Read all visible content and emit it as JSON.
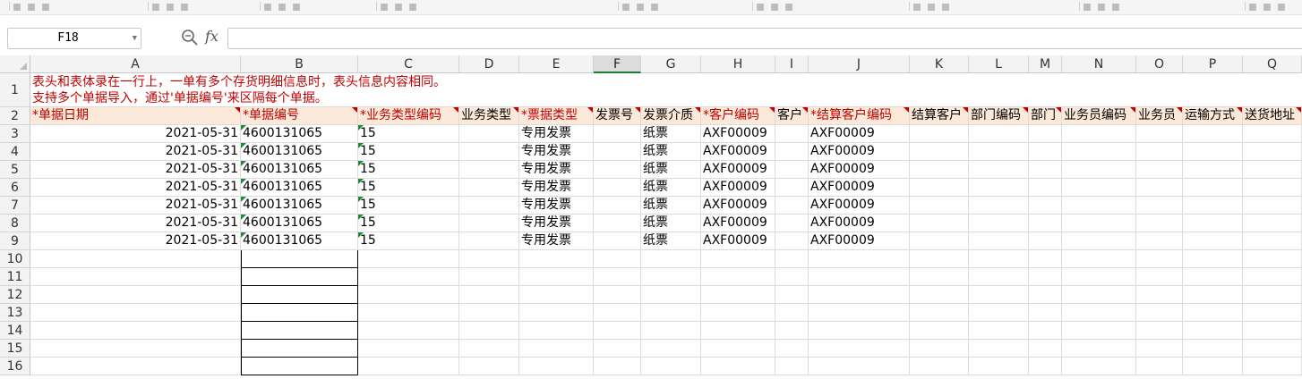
{
  "formula_bar": {
    "name_box": "F18",
    "fx_label": "fx",
    "formula": ""
  },
  "columns": [
    "A",
    "B",
    "C",
    "D",
    "E",
    "F",
    "G",
    "H",
    "I",
    "J",
    "K",
    "L",
    "M",
    "N",
    "O",
    "P",
    "Q"
  ],
  "selected_column": "F",
  "row_numbers": [
    "1",
    "2",
    "3",
    "4",
    "5",
    "6",
    "7",
    "8",
    "9",
    "10",
    "11",
    "12",
    "13",
    "14",
    "15",
    "16"
  ],
  "notes": {
    "line1": "表头和表体录在一行上，一单有多个存货明细信息时，表头信息内容相同。",
    "line2": "支持多个单据导入，通过'单据编号'来区隔每个单据。"
  },
  "headers": [
    {
      "text": "*单据日期",
      "required": true
    },
    {
      "text": "*单据编号",
      "required": true
    },
    {
      "text": "*业务类型编码",
      "required": true
    },
    {
      "text": "业务类型",
      "required": false
    },
    {
      "text": "*票据类型",
      "required": true
    },
    {
      "text": "发票号",
      "required": false
    },
    {
      "text": "发票介质",
      "required": false
    },
    {
      "text": "*客户编码",
      "required": true
    },
    {
      "text": "客户",
      "required": false
    },
    {
      "text": "*结算客户编码",
      "required": true
    },
    {
      "text": "结算客户",
      "required": false
    },
    {
      "text": "部门编码",
      "required": false
    },
    {
      "text": "部门",
      "required": false
    },
    {
      "text": "业务员编码",
      "required": false
    },
    {
      "text": "业务员",
      "required": false
    },
    {
      "text": "运输方式",
      "required": false
    },
    {
      "text": "送货地址",
      "required": false
    }
  ],
  "rows": [
    {
      "date": "2021-05-31",
      "doc_no": "4600131065",
      "biz_code": "15",
      "invoice_type": "专用发票",
      "medium": "纸票",
      "customer_code": "AXF00009",
      "settle_code": "AXF00009"
    },
    {
      "date": "2021-05-31",
      "doc_no": "4600131065",
      "biz_code": "15",
      "invoice_type": "专用发票",
      "medium": "纸票",
      "customer_code": "AXF00009",
      "settle_code": "AXF00009"
    },
    {
      "date": "2021-05-31",
      "doc_no": "4600131065",
      "biz_code": "15",
      "invoice_type": "专用发票",
      "medium": "纸票",
      "customer_code": "AXF00009",
      "settle_code": "AXF00009"
    },
    {
      "date": "2021-05-31",
      "doc_no": "4600131065",
      "biz_code": "15",
      "invoice_type": "专用发票",
      "medium": "纸票",
      "customer_code": "AXF00009",
      "settle_code": "AXF00009"
    },
    {
      "date": "2021-05-31",
      "doc_no": "4600131065",
      "biz_code": "15",
      "invoice_type": "专用发票",
      "medium": "纸票",
      "customer_code": "AXF00009",
      "settle_code": "AXF00009"
    },
    {
      "date": "2021-05-31",
      "doc_no": "4600131065",
      "biz_code": "15",
      "invoice_type": "专用发票",
      "medium": "纸票",
      "customer_code": "AXF00009",
      "settle_code": "AXF00009"
    },
    {
      "date": "2021-05-31",
      "doc_no": "4600131065",
      "biz_code": "15",
      "invoice_type": "专用发票",
      "medium": "纸票",
      "customer_code": "AXF00009",
      "settle_code": "AXF00009"
    }
  ],
  "colors": {
    "required_text": "#c00000",
    "header_fill": "#fde9d9",
    "selection_accent": "#1e7b34"
  },
  "icons": {
    "zoom": "zoom-formula-icon",
    "fx": "fx-icon"
  }
}
